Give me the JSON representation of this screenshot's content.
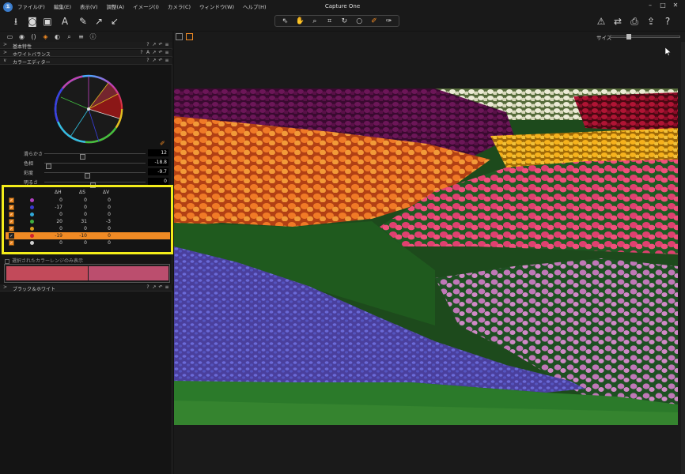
{
  "app": {
    "title": "Capture One",
    "logo": "①"
  },
  "menu": [
    "ファイル(F)",
    "編集(E)",
    "表示(V)",
    "調整(A)",
    "イメージ(I)",
    "カメラ(C)",
    "ウィンドウ(W)",
    "ヘルプ(H)"
  ],
  "window_controls": [
    "–",
    "□",
    "✕"
  ],
  "toolbar": {
    "left_icons": [
      {
        "name": "import-icon",
        "glyph": "⭳"
      },
      {
        "name": "capture-icon",
        "glyph": "◙"
      },
      {
        "name": "live-view-icon",
        "glyph": "▣"
      },
      {
        "name": "text-annotation-icon",
        "glyph": "A"
      },
      {
        "name": "brush-icon",
        "glyph": "✎"
      },
      {
        "name": "arrow-upright-icon",
        "glyph": "↗"
      },
      {
        "name": "arrow-downleft-icon",
        "glyph": "↙"
      }
    ],
    "cursor_tools": [
      {
        "name": "select-tool-icon",
        "glyph": "⇖"
      },
      {
        "name": "pan-tool-icon",
        "glyph": "✋"
      },
      {
        "name": "loupe-tool-icon",
        "glyph": "⌕"
      },
      {
        "name": "crop-tool-icon",
        "glyph": "⌗"
      },
      {
        "name": "rotate-tool-icon",
        "glyph": "↻"
      },
      {
        "name": "circle-tool-icon",
        "glyph": "○"
      },
      {
        "name": "color-picker-tool-icon",
        "glyph": "✐",
        "active": true
      },
      {
        "name": "wb-picker-tool-icon",
        "glyph": "✑"
      }
    ],
    "right_icons": [
      {
        "name": "warning-icon",
        "glyph": "⚠"
      },
      {
        "name": "copy-adjust-icon",
        "glyph": "⇄"
      },
      {
        "name": "print-icon",
        "glyph": "⎙"
      },
      {
        "name": "export-icon",
        "glyph": "⇪"
      },
      {
        "name": "help-icon",
        "glyph": "?"
      }
    ]
  },
  "tool_tabs": [
    {
      "name": "library-tab-icon",
      "glyph": "▭"
    },
    {
      "name": "capture-tab-icon",
      "glyph": "◉"
    },
    {
      "name": "lens-tab-icon",
      "glyph": "()"
    },
    {
      "name": "color-tab-icon",
      "glyph": "◈",
      "active": true
    },
    {
      "name": "exposure-tab-icon",
      "glyph": "◐"
    },
    {
      "name": "details-tab-icon",
      "glyph": "⌕"
    },
    {
      "name": "metadata-tab-icon",
      "glyph": "≡"
    },
    {
      "name": "info-tab-icon",
      "glyph": "ⓘ"
    }
  ],
  "viewer": {
    "size_label": "サイズ",
    "size_value": 0.25
  },
  "sections": [
    {
      "arrow": ">",
      "label": "基本特性",
      "icons": [
        "?",
        "↗",
        "↶",
        "≡"
      ]
    },
    {
      "arrow": ">",
      "label": "ホワイトバランス",
      "icons": [
        "?",
        "A",
        "↗",
        "↶",
        "≡"
      ]
    },
    {
      "arrow": "∨",
      "label": "カラーエディター",
      "icons": [
        "?",
        "↗",
        "↶",
        "≡"
      ]
    }
  ],
  "color_editor": {
    "sliders": [
      {
        "label": "滑らかさ",
        "value": "12",
        "pos": 0.37
      },
      {
        "label": "色相",
        "value": "-18.8",
        "pos": 0.02
      },
      {
        "label": "彩度",
        "value": "-9.7",
        "pos": 0.42
      },
      {
        "label": "明るさ",
        "value": "0",
        "pos": 0.48
      }
    ],
    "table_headers": [
      "ΔH",
      "ΔS",
      "ΔV"
    ],
    "rows": [
      {
        "color": "#b040c0",
        "dh": "0",
        "ds": "0",
        "dv": "0",
        "selected": false
      },
      {
        "color": "#3a3ad0",
        "dh": "-17",
        "ds": "0",
        "dv": "0",
        "selected": false
      },
      {
        "color": "#30a8d8",
        "dh": "0",
        "ds": "0",
        "dv": "0",
        "selected": false
      },
      {
        "color": "#40b040",
        "dh": "20",
        "ds": "31",
        "dv": "-3",
        "selected": false
      },
      {
        "color": "#d8a020",
        "dh": "0",
        "ds": "0",
        "dv": "0",
        "selected": false
      },
      {
        "color": "#d02030",
        "dh": "-19",
        "ds": "-10",
        "dv": "0",
        "selected": true
      },
      {
        "color": "#cfcfcf",
        "dh": "0",
        "ds": "0",
        "dv": "0",
        "selected": false
      }
    ],
    "show_selected_label": "選択されたカラーレンジのみ表示",
    "preview_before": "#c24a5a",
    "preview_after": "#bb4e6e"
  },
  "bw_section": {
    "arrow": ">",
    "label": "ブラック＆ホワイト",
    "icons": [
      "?",
      "↗",
      "↶",
      "≡"
    ]
  }
}
